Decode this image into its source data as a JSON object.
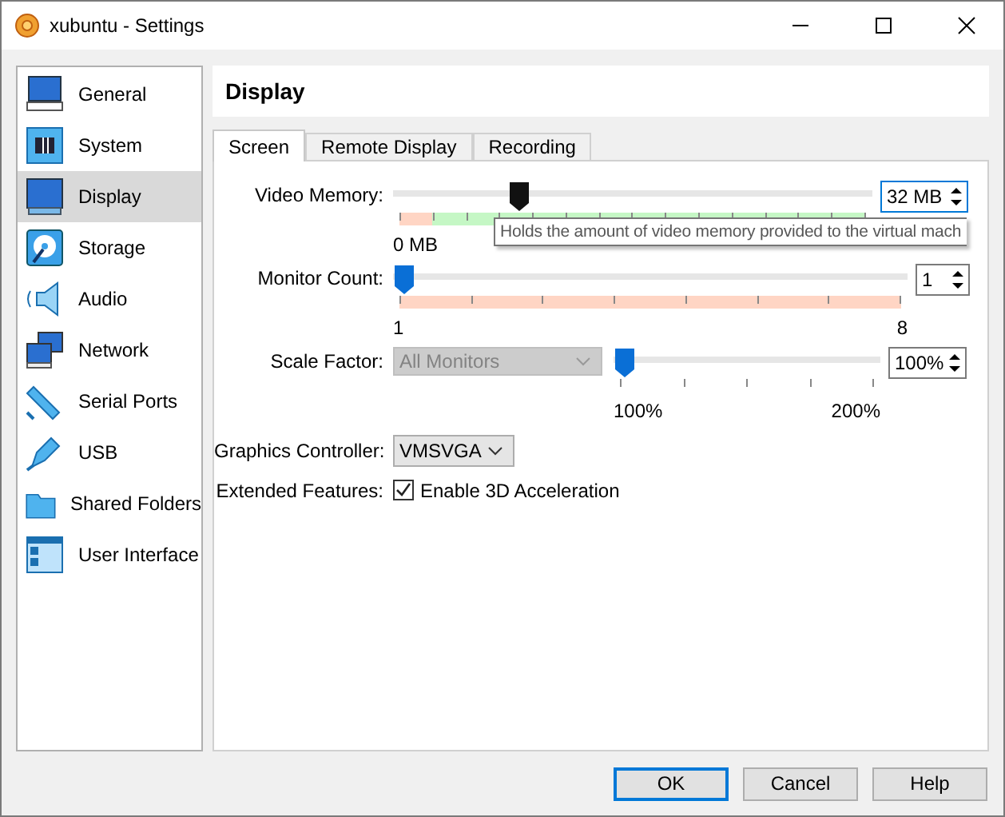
{
  "window": {
    "title": "xubuntu - Settings"
  },
  "sidebar": {
    "items": [
      {
        "label": "General",
        "selected": false
      },
      {
        "label": "System",
        "selected": false
      },
      {
        "label": "Display",
        "selected": true
      },
      {
        "label": "Storage",
        "selected": false
      },
      {
        "label": "Audio",
        "selected": false
      },
      {
        "label": "Network",
        "selected": false
      },
      {
        "label": "Serial Ports",
        "selected": false
      },
      {
        "label": "USB",
        "selected": false
      },
      {
        "label": "Shared Folders",
        "selected": false
      },
      {
        "label": "User Interface",
        "selected": false
      }
    ]
  },
  "page_title": "Display",
  "tabs": [
    {
      "label": "Screen",
      "selected": true
    },
    {
      "label": "Remote Display",
      "selected": false
    },
    {
      "label": "Recording",
      "selected": false
    }
  ],
  "video_memory": {
    "label": "Video Memory:",
    "level": 0.25,
    "focused": true,
    "value": "32 MB",
    "scale_min": "0 MB",
    "tooltip": "Holds the amount of video memory provided to the virtual mach"
  },
  "monitor_count": {
    "label": "Monitor Count:",
    "level": 0,
    "focused": false,
    "value": "1",
    "scale_min": "1",
    "scale_max": "8"
  },
  "scale_factor": {
    "label": "Scale Factor:",
    "monitor_select": {
      "value": "All Monitors",
      "disabled": true
    },
    "level": 0,
    "focused": false,
    "value": "100%",
    "scale_min": "100%",
    "scale_max": "200%"
  },
  "graphics_controller": {
    "label": "Graphics Controller:",
    "value": "VMSVGA"
  },
  "extended_features": {
    "label": "Extended Features:",
    "checkbox": {
      "label": "Enable 3D Acceleration",
      "checked": true
    }
  },
  "buttons": [
    {
      "label": "OK",
      "default": true
    },
    {
      "label": "Cancel",
      "default": false
    },
    {
      "label": "Help",
      "default": false
    }
  ]
}
